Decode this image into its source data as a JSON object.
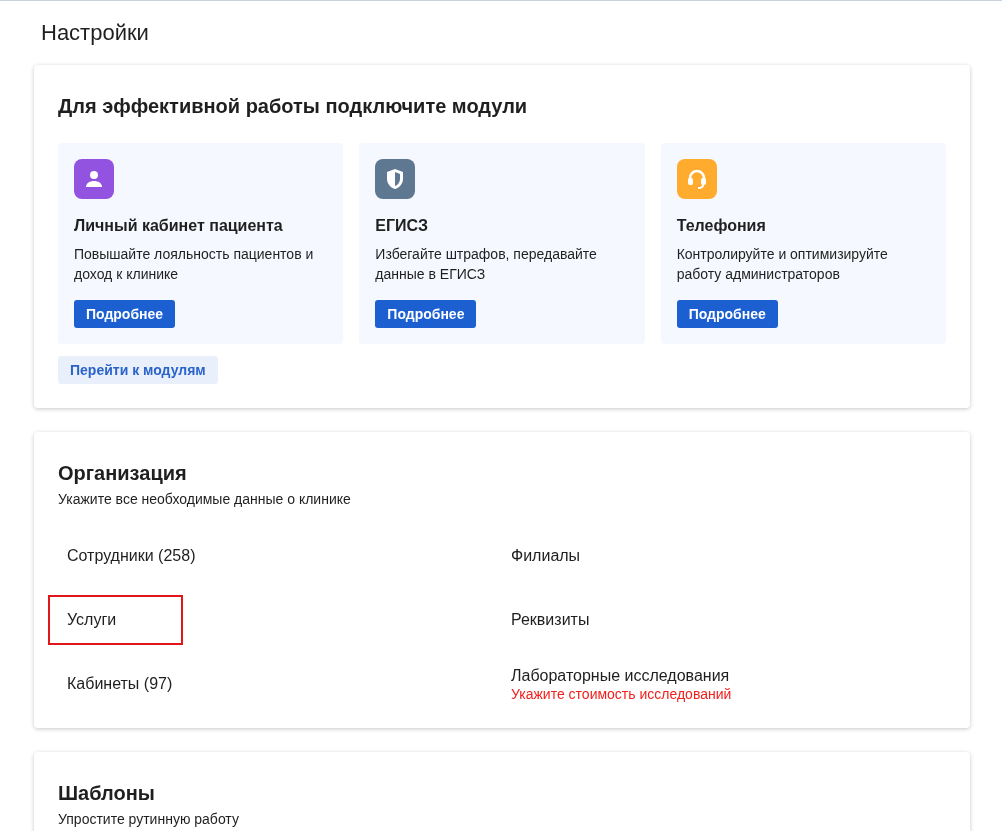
{
  "page_title": "Настройки",
  "modules": {
    "title": "Для эффективной работы подключите модули",
    "items": [
      {
        "kind": "person",
        "color": "#9153e0",
        "title": "Личный кабинет пациента",
        "description": "Повышайте лояльность пациентов и доход к клинике",
        "button": "Подробнее"
      },
      {
        "kind": "shield",
        "color": "#5f7891",
        "title": "ЕГИСЗ",
        "description": "Избегайте штрафов, передавайте данные в ЕГИСЗ",
        "button": "Подробнее"
      },
      {
        "kind": "headset",
        "color": "#ffab2e",
        "title": "Телефония",
        "description": "Контролируйте и оптимизируйте работу администраторов",
        "button": "Подробнее"
      }
    ],
    "link_button": "Перейти к модулям"
  },
  "organization": {
    "title": "Организация",
    "subtitle": "Укажите все необходимые данные о клинике",
    "items": [
      {
        "label": "Сотрудники (258)",
        "highlighted": false
      },
      {
        "label": "Услуги",
        "highlighted": true
      },
      {
        "label": "Кабинеты (97)",
        "highlighted": false
      },
      {
        "label": "Филиалы",
        "highlighted": false
      },
      {
        "label": "Реквизиты",
        "highlighted": false
      },
      {
        "label": "Лабораторные исследования",
        "warning": "Укажите стоимость исследований",
        "highlighted": false
      }
    ]
  },
  "templates": {
    "title": "Шаблоны",
    "subtitle": "Упростите рутинную работу"
  }
}
